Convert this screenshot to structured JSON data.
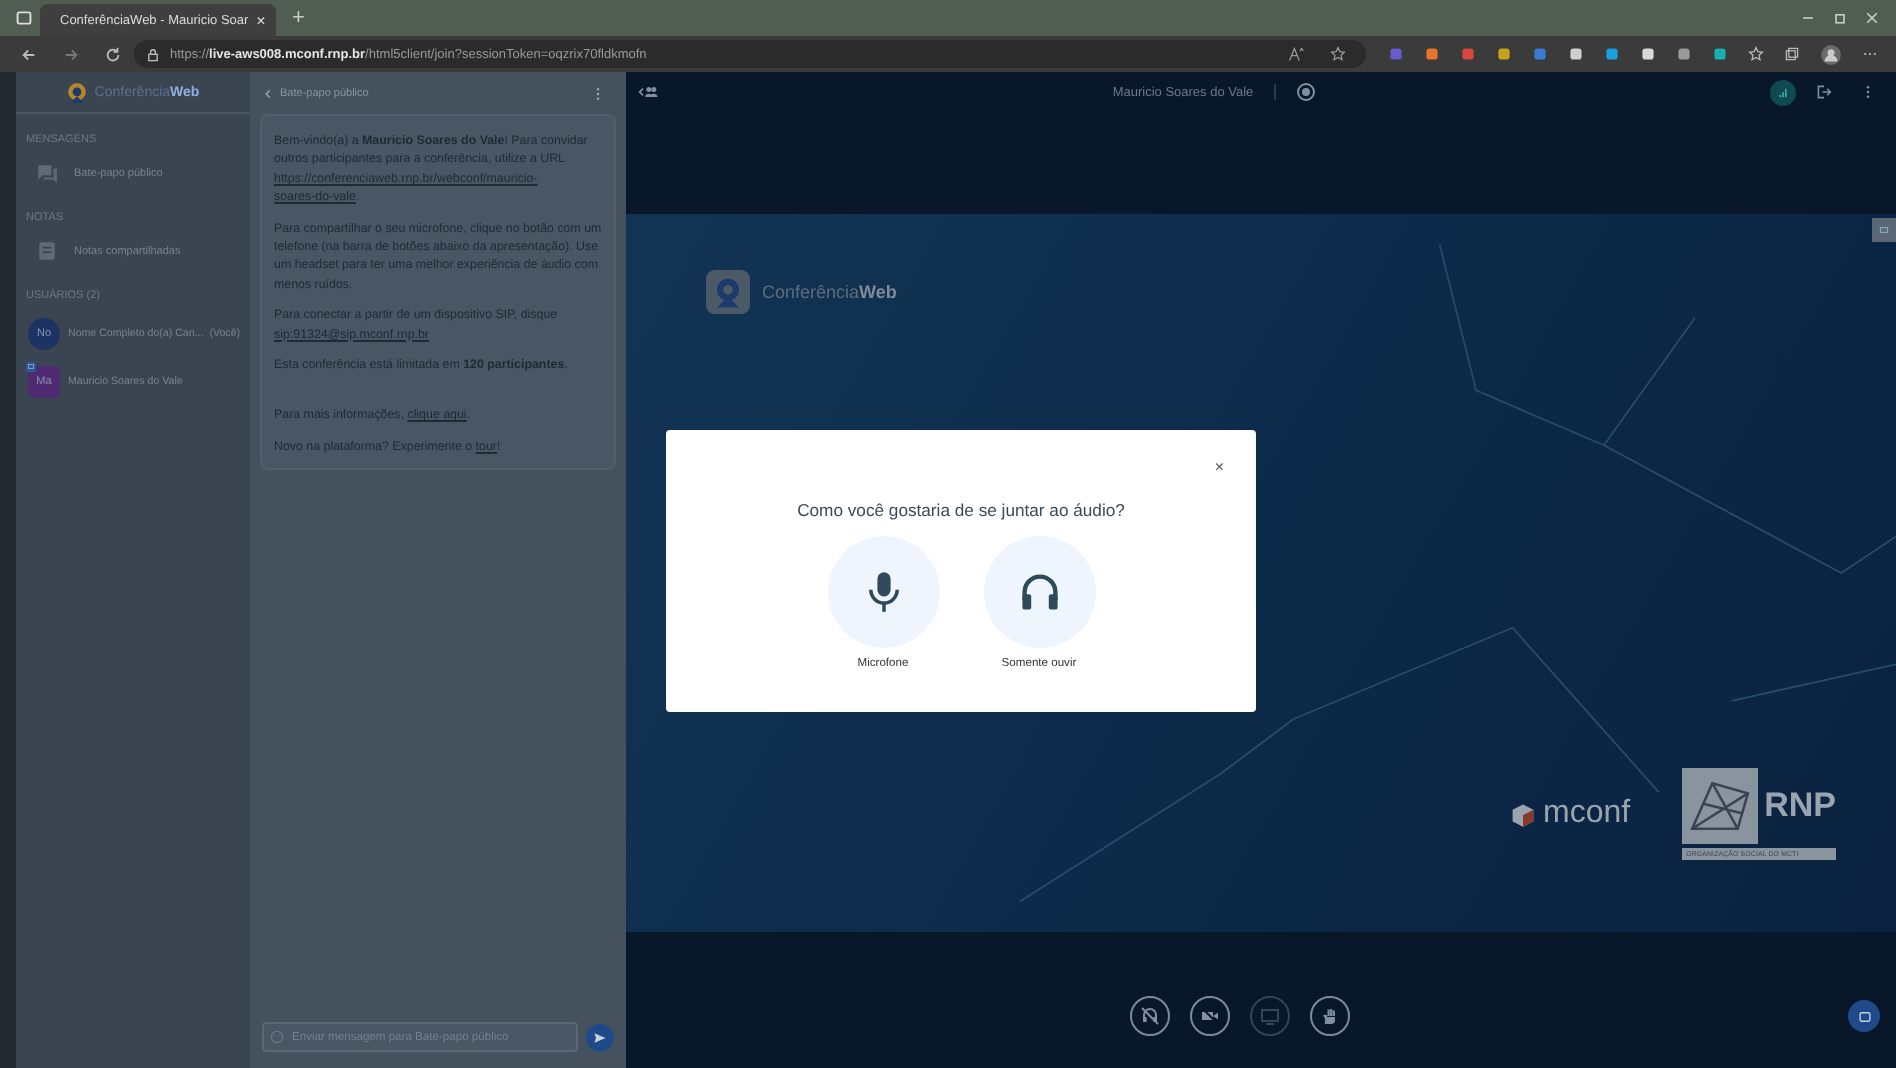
{
  "browser": {
    "tab_title": "ConferênciaWeb - Mauricio Soar",
    "tab_close": "×",
    "new_tab": "+",
    "url": "https://**live-aws008.mconf.rnp.br**/html5client/join?sessionToken=oqzrix70fldkmofn"
  },
  "sidebar": {
    "logo": "Conferência**Web**",
    "sections": [
      {
        "title": "MENSAGENS",
        "items": [
          {
            "kind": "chat",
            "label": "Bate-papo público"
          }
        ]
      },
      {
        "title": "NOTAS",
        "items": [
          {
            "kind": "notes",
            "label": "Notas compartilhadas"
          }
        ]
      }
    ],
    "users_title": "USUÁRIOS (2)",
    "users": [
      {
        "initials": "No",
        "name": "Nome Completo do(a) Can...",
        "suffix": "(Você)",
        "color": "#1c3364",
        "moderator": false
      },
      {
        "initials": "Ma",
        "name": "Mauricio Soares do Vale",
        "color": "#4e2a73",
        "moderator": true
      }
    ]
  },
  "chat": {
    "title": "Bate-papo público",
    "messages": [
      [
        {
          "kind": "text",
          "text": "Bem-vindo(a) a "
        },
        {
          "kind": "bold",
          "text": "Mauricio Soares do Vale"
        },
        {
          "kind": "text",
          "text": "! Para convidar outros participantes para a conferência, utilize a URL "
        },
        {
          "kind": "link",
          "text": "https://conferenciaweb.rnp.br/webconf/mauricio-"
        },
        {
          "kind": "link",
          "text": "soares-do-vale"
        },
        {
          "kind": "text",
          "text": "."
        }
      ],
      [
        {
          "kind": "text",
          "text": "Para compartilhar o seu microfone, clique no botão com um telefone (na barra de botões abaixo da apresentação). Use um headset para ter uma melhor experiência de áudio com menos ruídos."
        }
      ],
      [
        {
          "kind": "text",
          "text": "Para conectar a partir de um dispositivo SIP, disque "
        },
        {
          "kind": "link",
          "text": "sip:91324@sip.mconf.rnp.br"
        }
      ],
      [
        {
          "kind": "text",
          "text": "Esta conferência está limitada em "
        },
        {
          "kind": "bold",
          "text": "120 participantes"
        },
        {
          "kind": "text",
          "text": "."
        }
      ],
      [
        {
          "kind": "text",
          "text": "Para mais informações, "
        },
        {
          "kind": "link",
          "text": "clique aqui"
        },
        {
          "kind": "text",
          "text": "."
        }
      ],
      [
        {
          "kind": "text",
          "text": "Novo na plataforma? Experimente o "
        },
        {
          "kind": "link",
          "text": "tour"
        },
        {
          "kind": "text",
          "text": "!"
        }
      ]
    ],
    "input_placeholder": "Enviar mensagem para Bate-papo público"
  },
  "main": {
    "title": "Mauricio Soares do Vale",
    "presentation_logo": "Conferência**Web**",
    "mconf_logo": "mconf",
    "rnp_logo": "RNP",
    "rnp_caption": "ORGANIZAÇÃO SOCIAL DO MCTI",
    "controls": [
      {
        "kind": "audio",
        "disabled": false
      },
      {
        "kind": "video",
        "disabled": false
      },
      {
        "kind": "screen",
        "disabled": true
      },
      {
        "kind": "hand",
        "disabled": false
      }
    ]
  },
  "modal": {
    "close": "×",
    "title": "Como você gostaria de se juntar ao áudio?",
    "options": [
      {
        "kind": "mic",
        "label": "Microfone"
      },
      {
        "kind": "headphones",
        "label": "Somente ouvir"
      }
    ]
  }
}
